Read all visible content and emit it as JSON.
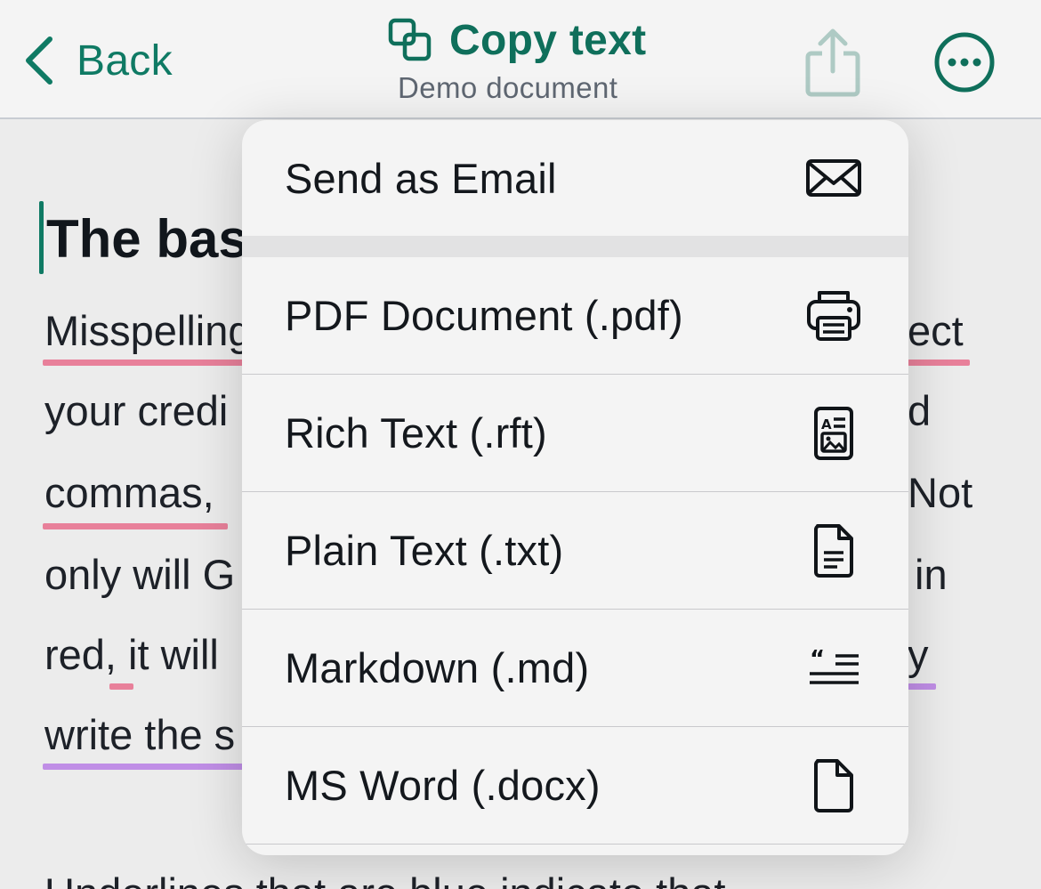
{
  "nav": {
    "back_label": "Back",
    "title": "Copy text",
    "subtitle": "Demo document",
    "icons": {
      "back": "chevron-left-icon",
      "title": "copy-icon",
      "share": "share-icon",
      "more": "ellipsis-circle-icon"
    }
  },
  "document": {
    "heading": "The bas",
    "lines": [
      {
        "left": "Misspelling",
        "right": "ect"
      },
      {
        "left": "your credi",
        "right": "d"
      },
      {
        "left": "commas,",
        "right": "Not"
      },
      {
        "left": "only will G",
        "right": "in"
      },
      {
        "left": "red, it will",
        "right": "y"
      },
      {
        "left": "write the s",
        "right": ""
      }
    ],
    "footer_partial": "Underlines that are blue indicate that"
  },
  "menu": {
    "items": [
      {
        "label": "Send as Email",
        "icon": "envelope-icon"
      },
      {
        "label": "PDF Document (.pdf)",
        "icon": "printer-icon"
      },
      {
        "label": "Rich Text (.rft)",
        "icon": "rich-text-document-icon"
      },
      {
        "label": "Plain Text (.txt)",
        "icon": "text-document-icon"
      },
      {
        "label": "Markdown (.md)",
        "icon": "quote-lines-icon"
      },
      {
        "label": "MS Word (.docx)",
        "icon": "blank-document-icon"
      }
    ]
  },
  "colors": {
    "accent": "#0f7a64",
    "misspell_underline": "#e8809a",
    "style_underline": "#c08ee6"
  }
}
